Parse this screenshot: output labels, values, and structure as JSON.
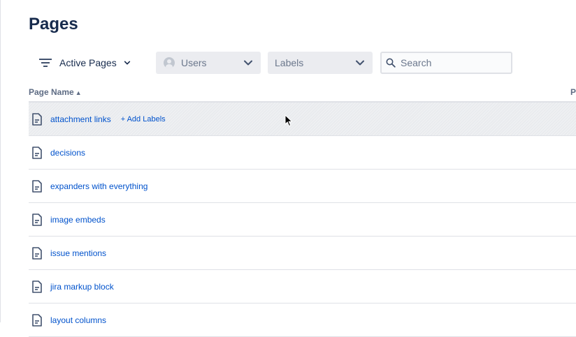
{
  "page": {
    "title": "Pages"
  },
  "filters": {
    "active_label": "Active Pages",
    "users_label": "Users",
    "labels_label": "Labels",
    "search_placeholder": "Search"
  },
  "table": {
    "columns": [
      {
        "label": "Page Name",
        "sort": "ascending"
      },
      {
        "label": "P"
      }
    ],
    "add_labels": "+ Add Labels",
    "rows": [
      {
        "title": "attachment links",
        "hovered": true
      },
      {
        "title": "decisions"
      },
      {
        "title": "expanders with everything"
      },
      {
        "title": "image embeds"
      },
      {
        "title": "issue mentions"
      },
      {
        "title": "jira markup block"
      },
      {
        "title": "layout columns"
      }
    ]
  },
  "colors": {
    "link": "#0052cc",
    "text": "#172b4d",
    "muted": "#6b778c",
    "dropdown_bg": "#ebecf0",
    "border": "#dfe1e6"
  },
  "icons": {
    "filter": "filter-lines-icon",
    "chevron": "chevron-down-icon",
    "user": "user-avatar-icon",
    "search": "search-icon",
    "page": "page-document-icon",
    "sort": "sort-ascending-icon"
  }
}
